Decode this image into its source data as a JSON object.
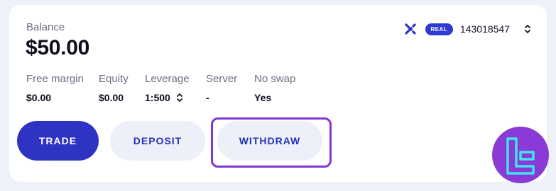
{
  "balance": {
    "label": "Balance",
    "value": "$50.00"
  },
  "account": {
    "badge": "REAL",
    "number": "143018547"
  },
  "stats": [
    {
      "label": "Free margin",
      "value": "$0.00"
    },
    {
      "label": "Equity",
      "value": "$0.00"
    },
    {
      "label": "Leverage",
      "value": "1:500"
    },
    {
      "label": "Server",
      "value": "-"
    },
    {
      "label": "No swap",
      "value": "Yes"
    }
  ],
  "actions": {
    "trade": "TRADE",
    "deposit": "DEPOSIT",
    "withdraw": "WITHDRAW"
  },
  "icons": {
    "brand": "exness-x-icon",
    "account_switch": "chevron-up-down-icon",
    "leverage_switch": "chevron-up-down-icon",
    "overlay_logo": "tc-logo-icon"
  },
  "colors": {
    "primary": "#2e33c4",
    "secondary_bg": "#edf0f8",
    "highlight": "#7d37d4",
    "logo_bg": "#8a3ad6",
    "logo_stroke": "#3fe6f0"
  }
}
